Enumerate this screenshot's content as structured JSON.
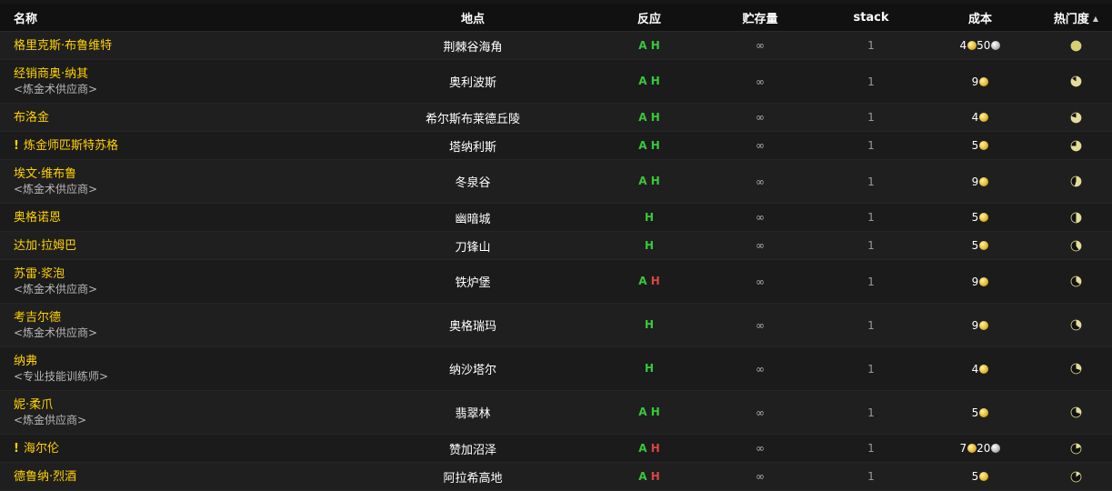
{
  "headers": {
    "name": "名称",
    "location": "地点",
    "reaction": "反应",
    "stock": "贮存量",
    "stack": "stack",
    "cost": "成本",
    "popularity": "热门度"
  },
  "colors": {
    "name": "#ffd100",
    "alliance": "#37c93b",
    "horde_friendly": "#37c93b",
    "horde_hostile": "#d94545",
    "gold_coin": "#e2b72e",
    "silver_coin": "#b8b8b8"
  },
  "rows": [
    {
      "name": "格里克斯·布鲁维特",
      "location": "荆棘谷海角",
      "a": "A",
      "h": "H",
      "a_show": true,
      "h_hostile": false,
      "stock": "∞",
      "stack": "1",
      "gold": "4",
      "silver": "50",
      "quest": false,
      "popularity": 1.0,
      "tag": ""
    },
    {
      "name": "经销商奥·纳其",
      "tag": "<炼金术供应商>",
      "location": "奥利波斯",
      "a": "A",
      "h": "H",
      "a_show": true,
      "h_hostile": false,
      "stock": "∞",
      "stack": "1",
      "gold": "9",
      "silver": "",
      "quest": false,
      "popularity": 0.85
    },
    {
      "name": "布洛金",
      "tag": "",
      "location": "希尔斯布莱德丘陵",
      "a": "A",
      "h": "H",
      "a_show": true,
      "h_hostile": false,
      "stock": "∞",
      "stack": "1",
      "gold": "4",
      "silver": "",
      "quest": false,
      "popularity": 0.8
    },
    {
      "name": "炼金师匹斯特苏格",
      "tag": "",
      "location": "塔纳利斯",
      "a": "A",
      "h": "H",
      "a_show": true,
      "h_hostile": false,
      "stock": "∞",
      "stack": "1",
      "gold": "5",
      "silver": "",
      "quest": true,
      "quest_mark": "!",
      "popularity": 0.75
    },
    {
      "name": "埃文·维布鲁",
      "tag": "<炼金术供应商>",
      "location": "冬泉谷",
      "a": "A",
      "h": "H",
      "a_show": true,
      "h_hostile": false,
      "stock": "∞",
      "stack": "1",
      "gold": "9",
      "silver": "",
      "quest": false,
      "popularity": 0.55
    },
    {
      "name": "奥格诺恩",
      "tag": "",
      "location": "幽暗城",
      "a": "",
      "h": "H",
      "a_show": false,
      "h_hostile": false,
      "stock": "∞",
      "stack": "1",
      "gold": "5",
      "silver": "",
      "quest": false,
      "popularity": 0.5
    },
    {
      "name": "达加·拉姆巴",
      "tag": "",
      "location": "刀锋山",
      "a": "",
      "h": "H",
      "a_show": false,
      "h_hostile": false,
      "stock": "∞",
      "stack": "1",
      "gold": "5",
      "silver": "",
      "quest": false,
      "popularity": 0.4
    },
    {
      "name": "苏雷·浆泡",
      "tag": "<炼金术供应商>",
      "location": "铁炉堡",
      "a": "A",
      "h": "H",
      "a_show": true,
      "h_hostile": true,
      "stock": "∞",
      "stack": "1",
      "gold": "9",
      "silver": "",
      "quest": false,
      "popularity": 0.35
    },
    {
      "name": "考吉尔德",
      "tag": "<炼金术供应商>",
      "location": "奥格瑞玛",
      "a": "",
      "h": "H",
      "a_show": false,
      "h_hostile": false,
      "stock": "∞",
      "stack": "1",
      "gold": "9",
      "silver": "",
      "quest": false,
      "popularity": 0.35
    },
    {
      "name": "纳弗",
      "tag": "<专业技能训练师>",
      "location": "纳沙塔尔",
      "a": "",
      "h": "H",
      "a_show": false,
      "h_hostile": false,
      "stock": "∞",
      "stack": "1",
      "gold": "4",
      "silver": "",
      "quest": false,
      "popularity": 0.3
    },
    {
      "name": "妮·柔爪",
      "tag": "<炼金供应商>",
      "location": "翡翠林",
      "a": "A",
      "h": "H",
      "a_show": true,
      "h_hostile": false,
      "stock": "∞",
      "stack": "1",
      "gold": "5",
      "silver": "",
      "quest": false,
      "popularity": 0.3
    },
    {
      "name": "海尔伦",
      "tag": "",
      "location": "赞加沼泽",
      "a": "A",
      "h": "H",
      "a_show": true,
      "h_hostile": true,
      "stock": "∞",
      "stack": "1",
      "gold": "7",
      "silver": "20",
      "quest": true,
      "quest_mark": "!",
      "popularity": 0.2
    },
    {
      "name": "德鲁纳·烈酒",
      "tag": "",
      "location": "阿拉希高地",
      "a": "A",
      "h": "H",
      "a_show": true,
      "h_hostile": true,
      "stock": "∞",
      "stack": "1",
      "gold": "5",
      "silver": "",
      "quest": false,
      "popularity": 0.15
    }
  ]
}
